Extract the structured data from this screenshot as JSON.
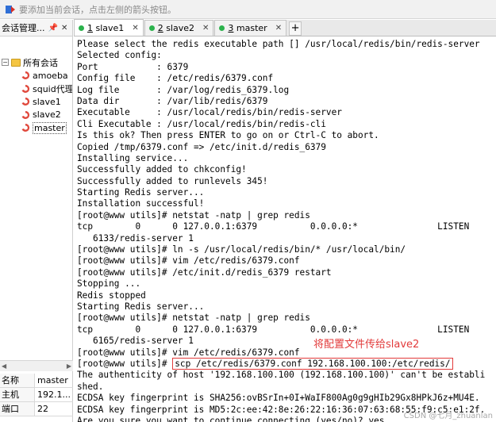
{
  "hint_bar": {
    "text": "要添加当前会话，点击左侧的箭头按钮。"
  },
  "session_panel": {
    "title": "会话管理...",
    "pin": "📌",
    "close": "✕",
    "tree": {
      "toggle": "−",
      "root_label": "所有会话",
      "items": [
        {
          "label": "amoeba"
        },
        {
          "label": "squid代理"
        },
        {
          "label": "slave1"
        },
        {
          "label": "slave2"
        },
        {
          "label": "master"
        }
      ]
    }
  },
  "property_grid": {
    "rows": [
      {
        "key": "名称",
        "value": "master"
      },
      {
        "key": "主机",
        "value": "192.1..."
      },
      {
        "key": "端口",
        "value": "22"
      }
    ]
  },
  "tabs": [
    {
      "number": "1",
      "label": "slave1",
      "status_color": "#2bb24c"
    },
    {
      "number": "2",
      "label": "slave2",
      "status_color": "#2bb24c"
    },
    {
      "number": "3",
      "label": "master",
      "status_color": "#2bb24c"
    }
  ],
  "tab_add_label": "+",
  "terminal": {
    "lines": [
      "Please select the redis executable path [] /usr/local/redis/bin/redis-server",
      "Selected config:",
      "Port           : 6379",
      "Config file    : /etc/redis/6379.conf",
      "Log file       : /var/log/redis_6379.log",
      "Data dir       : /var/lib/redis/6379",
      "Executable     : /usr/local/redis/bin/redis-server",
      "Cli Executable : /usr/local/redis/bin/redis-cli",
      "Is this ok? Then press ENTER to go on or Ctrl-C to abort.",
      "Copied /tmp/6379.conf => /etc/init.d/redis_6379",
      "Installing service...",
      "Successfully added to chkconfig!",
      "Successfully added to runlevels 345!",
      "Starting Redis server...",
      "Installation successful!",
      "[root@www utils]# netstat -natp | grep redis",
      "tcp        0      0 127.0.0.1:6379          0.0.0.0:*               LISTEN",
      "   6133/redis-server 1",
      "[root@www utils]# ln -s /usr/local/redis/bin/* /usr/local/bin/",
      "[root@www utils]# vim /etc/redis/6379.conf",
      "[root@www utils]# /etc/init.d/redis_6379 restart",
      "Stopping ...",
      "Redis stopped",
      "Starting Redis server...",
      "[root@www utils]# netstat -natp | grep redis",
      "tcp        0      0 127.0.0.1:6379          0.0.0.0:*               LISTEN",
      "   6165/redis-server 1",
      "[root@www utils]# vim /etc/redis/6379.conf"
    ],
    "scp_prompt": "[root@www utils]# ",
    "scp_command": "scp /etc/redis/6379.conf 192.168.100.100:/etc/redis/",
    "after_lines": [
      "The authenticity of host '192.168.100.100 (192.168.100.100)' can't be establi",
      "shed.",
      "ECDSA key fingerprint is SHA256:ovBSrIn+0I+WaIF800Ag0g9gHIb29Gx8HPkJ6z+MU4E.",
      "ECDSA key fingerprint is MD5:2c:ee:42:8e:26:22:16:36:07:63:68:55:f9:c5:e1:2f.",
      "Are you sure you want to continue connecting (yes/no)? yes"
    ],
    "annotation": "将配置文件传给slave2"
  },
  "watermark": "CSDN @七月_zhuanlan"
}
